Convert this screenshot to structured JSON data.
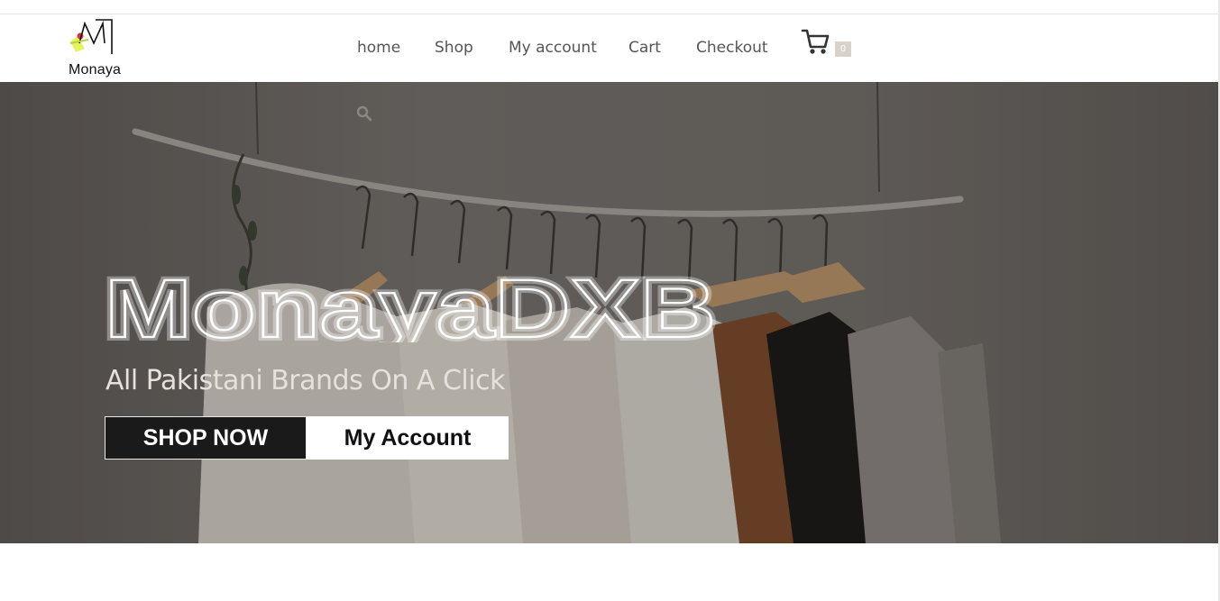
{
  "brand": {
    "logo_text": "Monaya"
  },
  "nav": {
    "items": [
      {
        "label": "home"
      },
      {
        "label": "Shop"
      },
      {
        "label": "My account"
      },
      {
        "label": "Cart"
      },
      {
        "label": "Checkout"
      }
    ]
  },
  "cart": {
    "icon": "shopping-cart-icon",
    "count": "0"
  },
  "hero": {
    "search_icon": "search-icon",
    "title": "MonayaDXB",
    "subtitle": "All Pakistani Brands On A Click",
    "shop_button": "SHOP NOW",
    "account_button": "My Account"
  },
  "colors": {
    "accent_badge": "#d8d2c8",
    "hero_overlay": "#6d6864",
    "shop_button_bg": "#1b1a1a"
  }
}
